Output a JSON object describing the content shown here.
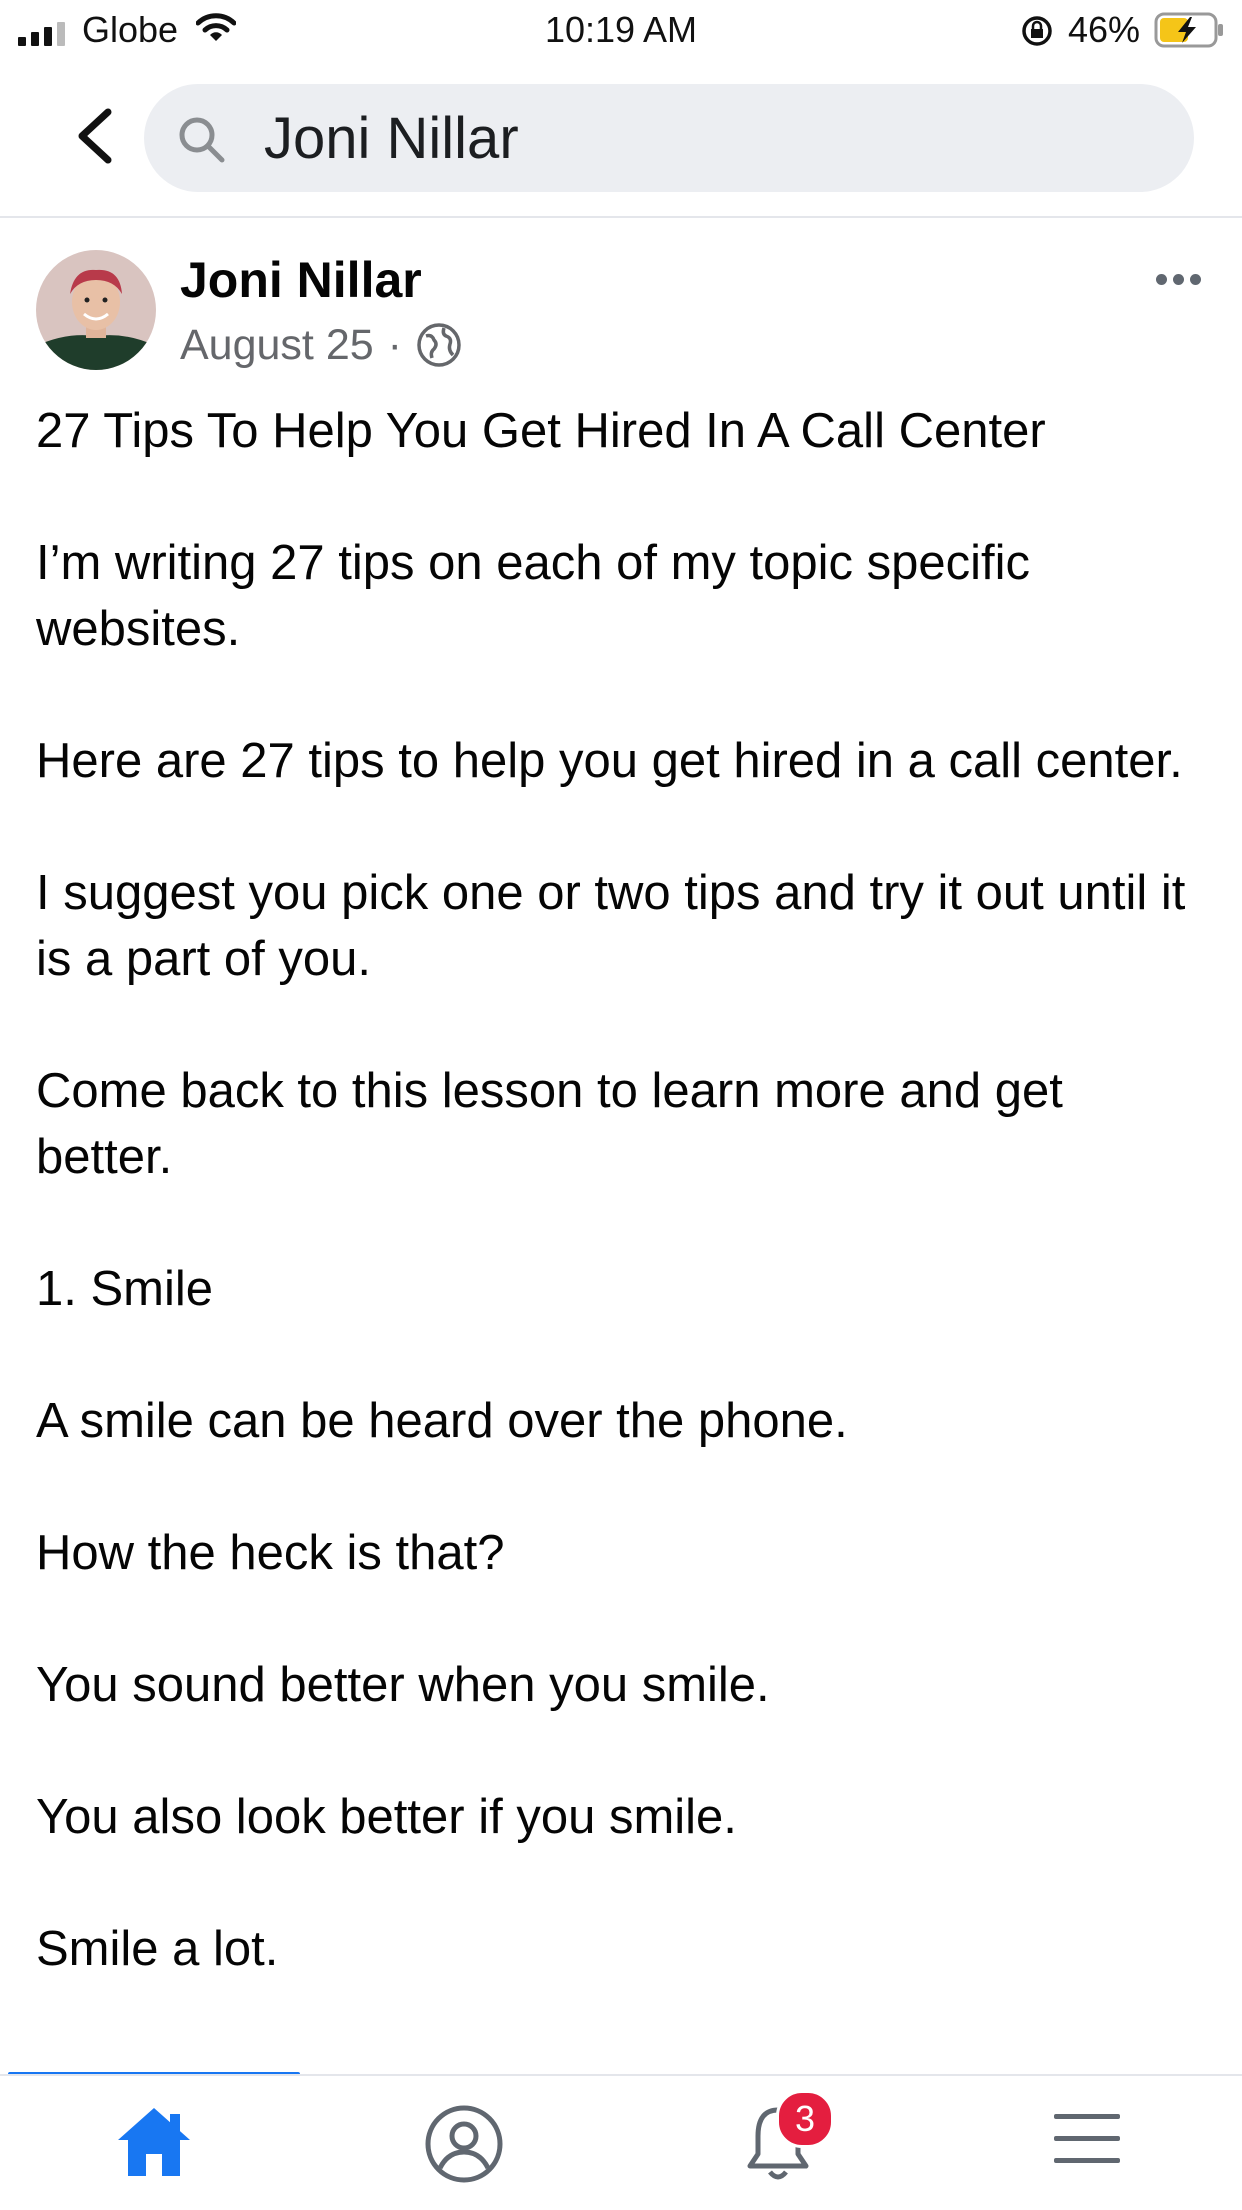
{
  "status_bar": {
    "carrier": "Globe",
    "time": "10:19 AM",
    "battery_percent": "46%"
  },
  "search": {
    "query": "Joni Nillar"
  },
  "post": {
    "author": "Joni Nillar",
    "date": "August 25",
    "separator": "·",
    "paragraphs": [
      "27 Tips To Help You Get Hired In A Call Center",
      "I’m writing 27 tips on each of my topic specific websites.",
      "Here are 27 tips to help you get hired in a call center.",
      "I suggest you pick one or two tips and try it out until it is a part of you.",
      "Come back to this lesson to learn more and get better.",
      "1. Smile",
      "A smile can be heard over the phone.",
      "How the heck is that?",
      "You sound better when you smile.",
      "You also look better if you smile.",
      "Smile a lot."
    ]
  },
  "bottom_nav": {
    "notifications_count": "3",
    "active_tab": "home"
  },
  "icons": {
    "back": "chevron-left-icon",
    "search": "search-icon",
    "privacy": "globe-icon",
    "more": "more-horizontal-icon",
    "home": "home-icon",
    "profile": "profile-icon",
    "notifications": "bell-icon",
    "menu": "menu-icon"
  },
  "colors": {
    "accent": "#1877f2",
    "badge": "#e41e3f",
    "battery_charging": "#f5c518",
    "secondary_text": "#65676b"
  }
}
